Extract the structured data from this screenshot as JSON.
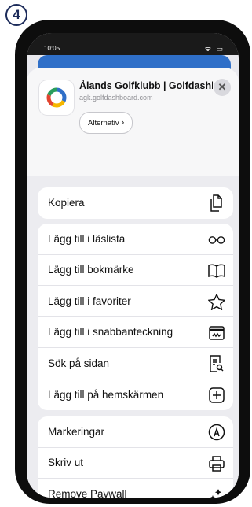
{
  "step_number": "4",
  "status": {
    "time": "10:05",
    "icons": "ᯤ ▭"
  },
  "share": {
    "site_title": "Ålands Golfklubb | Golfdashb",
    "site_url": "agk.golfdashboard.com",
    "close_glyph": "✕",
    "options_label": "Alternativ",
    "options_chevron": "›"
  },
  "groups": [
    {
      "items": [
        {
          "label": "Kopiera",
          "icon": "copy-icon"
        }
      ]
    },
    {
      "items": [
        {
          "label": "Lägg till i läslista",
          "icon": "glasses-icon"
        },
        {
          "label": "Lägg till bokmärke",
          "icon": "book-icon"
        },
        {
          "label": "Lägg till i favoriter",
          "icon": "star-icon"
        },
        {
          "label": "Lägg till i snabbanteckning",
          "icon": "quick-note-icon"
        },
        {
          "label": "Sök på sidan",
          "icon": "find-on-page-icon"
        },
        {
          "label": "Lägg till på hemskärmen",
          "icon": "add-square-icon"
        }
      ]
    },
    {
      "items": [
        {
          "label": "Markeringar",
          "icon": "markup-icon"
        },
        {
          "label": "Skriv ut",
          "icon": "printer-icon"
        },
        {
          "label": "Remove Paywall",
          "icon": "sparkles-icon"
        }
      ]
    }
  ],
  "colors": {
    "accent": "#2f6fc8",
    "badge": "#1c2b5a"
  }
}
